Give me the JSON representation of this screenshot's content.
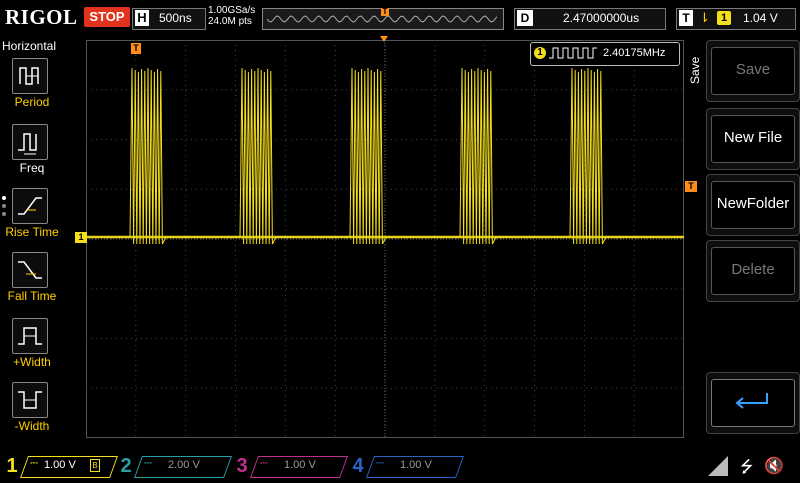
{
  "topbar": {
    "brand": "RIGOL",
    "run_state": "STOP",
    "timebase_key": "H",
    "timebase": "500ns",
    "sample_rate": "1.00GSa/s",
    "memory_depth": "24.0M pts",
    "delay_key": "D",
    "delay": "2.47000000us",
    "trigger_key": "T",
    "trigger_source": "1",
    "trigger_level": "1.04 V"
  },
  "left_menu": {
    "title": "Horizontal",
    "items": [
      {
        "label": "Period",
        "icon": "period-icon"
      },
      {
        "label": "Freq",
        "icon": "freq-icon"
      },
      {
        "label": "Rise Time",
        "icon": "rise-time-icon"
      },
      {
        "label": "Fall Time",
        "icon": "fall-time-icon"
      },
      {
        "label": "+Width",
        "icon": "positive-width-icon"
      },
      {
        "label": "-Width",
        "icon": "negative-width-icon"
      }
    ]
  },
  "measurement": {
    "channel": "1",
    "value": "2.40175MHz"
  },
  "markers": {
    "channel1": "1",
    "trigger_time": "T",
    "trigger_level": "T"
  },
  "right_menu": {
    "tab": "Save",
    "buttons": [
      {
        "label": "Save",
        "enabled": false
      },
      {
        "label": "New File",
        "enabled": true
      },
      {
        "label": "NewFolder",
        "enabled": true
      },
      {
        "label": "Delete",
        "enabled": false
      }
    ]
  },
  "channels": [
    {
      "num": "1",
      "scale": "1.00 V",
      "color": "#f3df1b",
      "active": true
    },
    {
      "num": "2",
      "scale": "2.00 V",
      "color": "#2aa0a4",
      "active": false
    },
    {
      "num": "3",
      "scale": "1.00 V",
      "color": "#c0308f",
      "active": false
    },
    {
      "num": "4",
      "scale": "1.00 V",
      "color": "#2b62c4",
      "active": false
    }
  ],
  "waveform": {
    "color": "#f3df1b",
    "bursts": 5,
    "pulses_per_burst": 10
  }
}
